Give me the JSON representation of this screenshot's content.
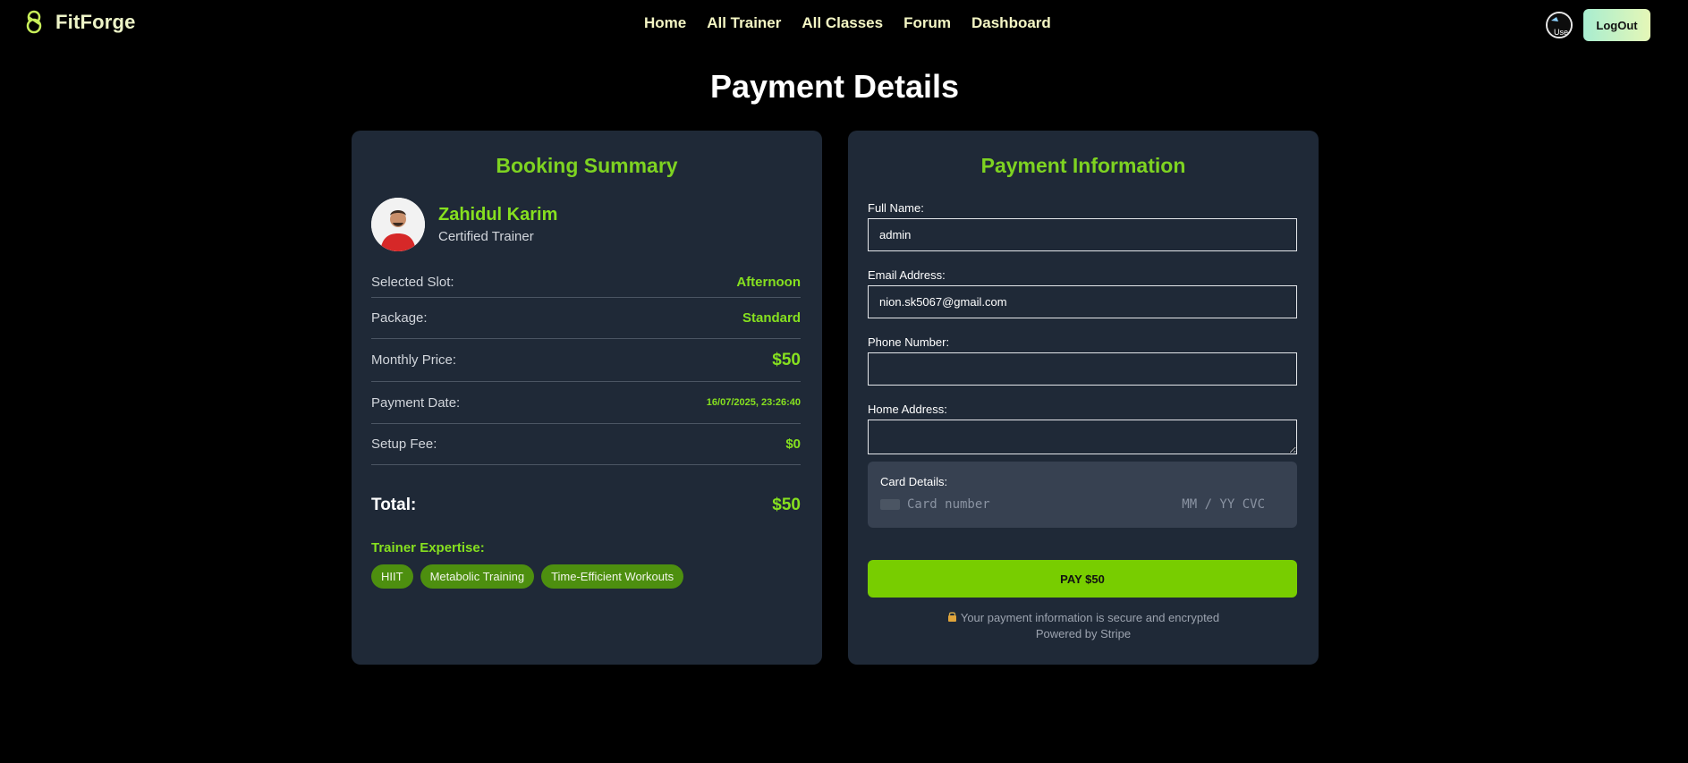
{
  "nav": {
    "brand": "FitForge",
    "links": [
      "Home",
      "All Trainer",
      "All Classes",
      "Forum",
      "Dashboard"
    ],
    "logout": "LogOut",
    "avatar_alt_text": "Use"
  },
  "page_title": "Payment Details",
  "booking": {
    "title": "Booking Summary",
    "trainer_name": "Zahidul Karim",
    "trainer_role": "Certified Trainer",
    "rows": [
      {
        "label": "Selected Slot:",
        "value": "Afternoon"
      },
      {
        "label": "Package:",
        "value": "Standard"
      },
      {
        "label": "Monthly Price:",
        "value": "$50"
      },
      {
        "label": "Payment Date:",
        "value": "16/07/2025, 23:26:40"
      },
      {
        "label": "Setup Fee:",
        "value": "$0"
      }
    ],
    "total_label": "Total:",
    "total_value": "$50",
    "expertise_label": "Trainer Expertise:",
    "tags": [
      "HIIT",
      "Metabolic Training",
      "Time-Efficient Workouts"
    ]
  },
  "payment": {
    "title": "Payment Information",
    "full_name_label": "Full Name:",
    "full_name_value": "admin",
    "email_label": "Email Address:",
    "email_value": "nion.sk5067@gmail.com",
    "phone_label": "Phone Number:",
    "phone_value": "",
    "address_label": "Home Address:",
    "address_value": "",
    "card_label": "Card Details:",
    "card_number_placeholder": "Card number",
    "card_exp_placeholder": "MM / YY CVC",
    "pay_button": "PAY $50",
    "secure_note": "Your payment information is secure and encrypted",
    "powered_by": "Powered by Stripe"
  },
  "colors": {
    "background": "#000000",
    "card": "#1f2937",
    "accent": "#7ed321",
    "pay_button": "#78cd00",
    "tag": "#4d8f0f"
  },
  "icons": {
    "brand": "kettlebell-icon",
    "lock": "lock-icon"
  }
}
